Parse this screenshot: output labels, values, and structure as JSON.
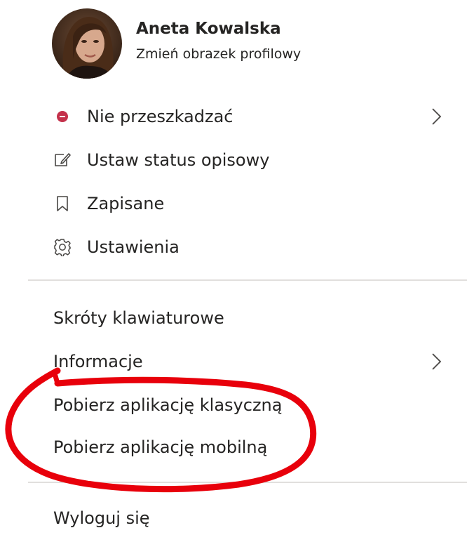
{
  "profile": {
    "name": "Aneta Kowalska",
    "change_picture": "Zmień obrazek profilowy"
  },
  "status_items": [
    {
      "label": "Nie przeszkadzać",
      "icon": "status-do-not-disturb-icon",
      "color": "#c4314b"
    },
    {
      "label": "Ustaw status opisowy",
      "icon": "edit-status-icon"
    },
    {
      "label": "Zapisane",
      "icon": "bookmark-icon"
    },
    {
      "label": "Ustawienia",
      "icon": "gear-icon"
    }
  ],
  "extra_items": [
    {
      "label": "Skróty klawiaturowe"
    },
    {
      "label": "Informacje"
    },
    {
      "label": "Pobierz aplikację klasyczną"
    },
    {
      "label": "Pobierz aplikację mobilną"
    }
  ],
  "signout": {
    "label": "Wyloguj się"
  },
  "annotation_color": "#e8000b"
}
